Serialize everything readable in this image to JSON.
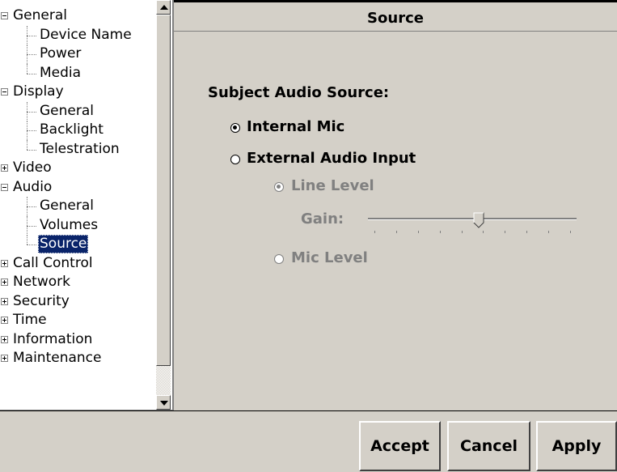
{
  "tree": {
    "nodes": [
      {
        "label": "General",
        "level": 0,
        "expander": "minus"
      },
      {
        "label": "Device Name",
        "level": 1
      },
      {
        "label": "Power",
        "level": 1
      },
      {
        "label": "Media",
        "level": 1
      },
      {
        "label": "Display",
        "level": 0,
        "expander": "minus"
      },
      {
        "label": "General",
        "level": 1
      },
      {
        "label": "Backlight",
        "level": 1
      },
      {
        "label": "Telestration",
        "level": 1
      },
      {
        "label": "Video",
        "level": 0,
        "expander": "plus"
      },
      {
        "label": "Audio",
        "level": 0,
        "expander": "minus"
      },
      {
        "label": "General",
        "level": 1
      },
      {
        "label": "Volumes",
        "level": 1
      },
      {
        "label": "Source",
        "level": 1,
        "selected": true
      },
      {
        "label": "Call Control",
        "level": 0,
        "expander": "plus"
      },
      {
        "label": "Network",
        "level": 0,
        "expander": "plus"
      },
      {
        "label": "Security",
        "level": 0,
        "expander": "plus"
      },
      {
        "label": "Time",
        "level": 0,
        "expander": "plus"
      },
      {
        "label": "Information",
        "level": 0,
        "expander": "plus"
      },
      {
        "label": "Maintenance",
        "level": 0,
        "expander": "plus"
      }
    ]
  },
  "panel": {
    "title": "Source",
    "subject_heading": "Subject Audio Source:",
    "internal_mic": "Internal Mic",
    "external_input": "External Audio Input",
    "line_level": "Line Level",
    "gain_label": "Gain:",
    "mic_level": "Mic Level",
    "gain_value_fraction": 0.53,
    "tick_count": 10
  },
  "buttons": {
    "accept": "Accept",
    "cancel": "Cancel",
    "apply": "Apply"
  },
  "colors": {
    "selection": "#0a246a",
    "disabled_text": "#808080",
    "face": "#d4d0c8"
  }
}
